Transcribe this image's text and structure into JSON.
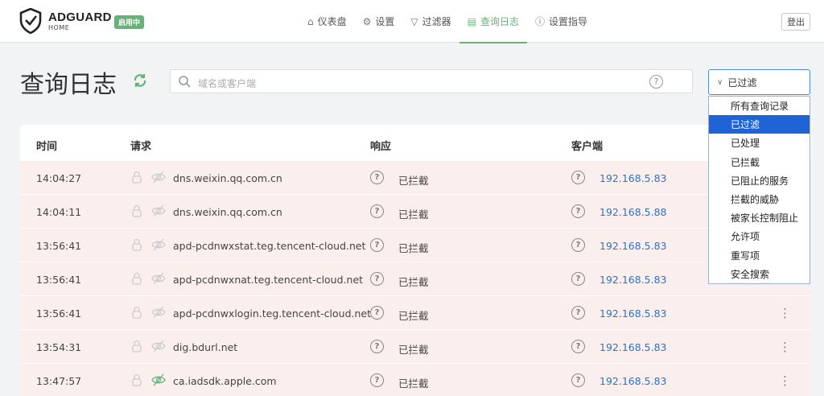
{
  "header": {
    "logo_name": "ADGUARD",
    "logo_sub": "HOME",
    "badge": "启用中",
    "nav": [
      {
        "label": "仪表盘",
        "icon": "home-icon",
        "active": false
      },
      {
        "label": "设置",
        "icon": "gear-icon",
        "active": false
      },
      {
        "label": "过滤器",
        "icon": "filter-icon",
        "active": false
      },
      {
        "label": "查询日志",
        "icon": "document-icon",
        "active": true
      },
      {
        "label": "设置指导",
        "icon": "help-icon",
        "active": false
      }
    ],
    "logout": "登出"
  },
  "page": {
    "title": "查询日志"
  },
  "search": {
    "placeholder": "域名或客户端"
  },
  "filter": {
    "selected": "已过滤",
    "options": [
      "所有查询记录",
      "已过滤",
      "已处理",
      "已拦截",
      "已阻止的服务",
      "拦截的威胁",
      "被家长控制阻止",
      "允许项",
      "重写项",
      "安全搜索"
    ]
  },
  "table": {
    "headers": {
      "time": "时间",
      "request": "请求",
      "response": "响应",
      "client": "客户端"
    },
    "rows": [
      {
        "time": "14:04:27",
        "domain": "dns.weixin.qq.com.cn",
        "response": "已拦截",
        "client": "192.168.5.83",
        "eye_green": false,
        "more": false
      },
      {
        "time": "14:04:11",
        "domain": "dns.weixin.qq.com.cn",
        "response": "已拦截",
        "client": "192.168.5.88",
        "eye_green": false,
        "more": false
      },
      {
        "time": "13:56:41",
        "domain": "apd-pcdnwxstat.teg.tencent-cloud.net",
        "response": "已拦截",
        "client": "192.168.5.83",
        "eye_green": false,
        "more": false
      },
      {
        "time": "13:56:41",
        "domain": "apd-pcdnwxnat.teg.tencent-cloud.net",
        "response": "已拦截",
        "client": "192.168.5.83",
        "eye_green": false,
        "more": false
      },
      {
        "time": "13:56:41",
        "domain": "apd-pcdnwxlogin.teg.tencent-cloud.net",
        "response": "已拦截",
        "client": "192.168.5.83",
        "eye_green": false,
        "more": true
      },
      {
        "time": "13:54:31",
        "domain": "dig.bdurl.net",
        "response": "已拦截",
        "client": "192.168.5.83",
        "eye_green": false,
        "more": true
      },
      {
        "time": "13:47:57",
        "domain": "ca.iadsdk.apple.com",
        "response": "已拦截",
        "client": "192.168.5.83",
        "eye_green": true,
        "more": true
      }
    ]
  },
  "colors": {
    "accent": "#67b279",
    "row_blocked": "#fbefee",
    "link": "#2f73c1",
    "selected_option": "#1e64d6"
  }
}
